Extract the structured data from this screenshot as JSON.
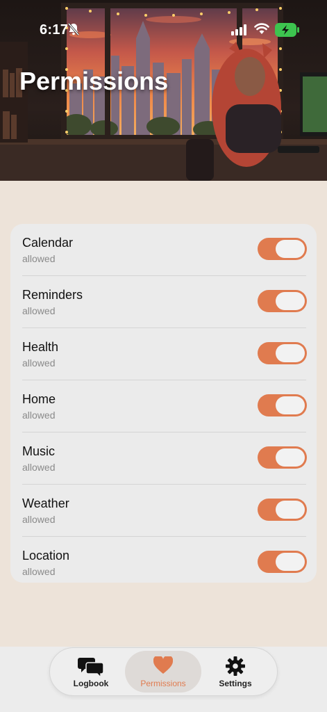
{
  "status_bar": {
    "time": "6:17"
  },
  "header": {
    "title": "Permissions"
  },
  "colors": {
    "accent": "#e07b4f",
    "background": "#ede3d9",
    "card": "#ebebeb",
    "battery": "#3dc44f"
  },
  "permissions": [
    {
      "label": "Calendar",
      "status": "allowed",
      "enabled": true
    },
    {
      "label": "Reminders",
      "status": "allowed",
      "enabled": true
    },
    {
      "label": "Health",
      "status": "allowed",
      "enabled": true
    },
    {
      "label": "Home",
      "status": "allowed",
      "enabled": true
    },
    {
      "label": "Music",
      "status": "allowed",
      "enabled": true
    },
    {
      "label": "Weather",
      "status": "allowed",
      "enabled": true
    },
    {
      "label": "Location",
      "status": "allowed",
      "enabled": true
    }
  ],
  "tabs": [
    {
      "label": "Logbook",
      "icon": "chat-bubbles-icon",
      "active": false
    },
    {
      "label": "Permissions",
      "icon": "heart-icon",
      "active": true
    },
    {
      "label": "Settings",
      "icon": "gear-icon",
      "active": false
    }
  ]
}
